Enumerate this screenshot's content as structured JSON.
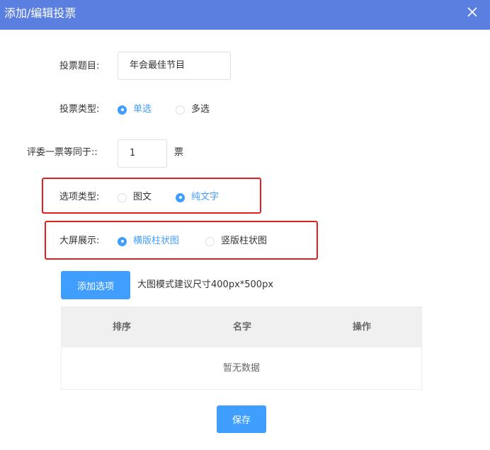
{
  "dialog": {
    "title": "添加/编辑投票",
    "close_icon": "close-icon"
  },
  "form": {
    "vote_title": {
      "label": "投票题目:",
      "value": "年会最佳节目"
    },
    "vote_type": {
      "label": "投票类型:",
      "options": [
        "单选",
        "多选"
      ],
      "selected": "单选"
    },
    "judge_weight": {
      "label": "评委一票等同于::",
      "value": "1",
      "unit": "票"
    },
    "option_type": {
      "label": "选项类型:",
      "options": [
        "图文",
        "纯文字"
      ],
      "selected": "纯文字"
    },
    "big_screen": {
      "label": "大屏展示:",
      "options": [
        "横版柱状图",
        "竖版柱状图"
      ],
      "selected": "横版柱状图"
    }
  },
  "add_option": {
    "button_label": "添加选项",
    "hint": "大图模式建议尺寸400px*500px"
  },
  "table": {
    "columns": [
      "排序",
      "名字",
      "操作"
    ],
    "empty_text": "暂无数据"
  },
  "footer": {
    "save_label": "保存"
  },
  "colors": {
    "header_bg": "#5a7fe0",
    "accent": "#409eff",
    "highlight_border": "#e02020"
  }
}
